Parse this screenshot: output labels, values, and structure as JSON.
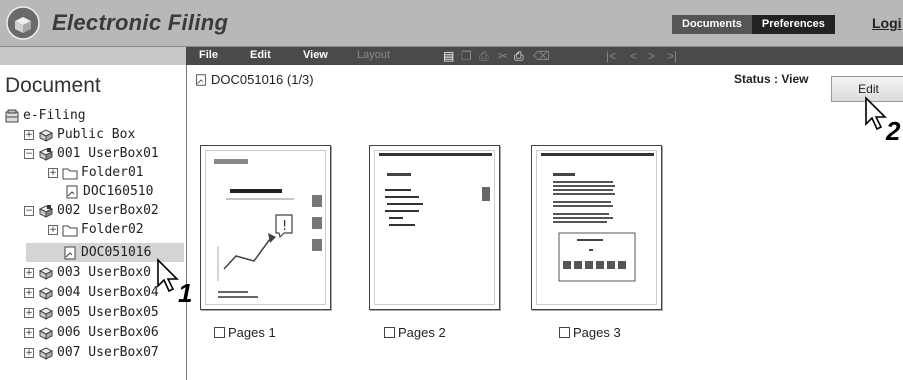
{
  "header": {
    "title": "Electronic Filing",
    "tabs": [
      {
        "label": "Documents"
      },
      {
        "label": "Preferences"
      }
    ],
    "login_label": "Logi"
  },
  "toolbar": {
    "menus": [
      {
        "label": "File"
      },
      {
        "label": "Edit"
      },
      {
        "label": "View"
      },
      {
        "label": "Layout"
      }
    ],
    "icons": [
      "display-icon",
      "copy-icon",
      "print-icon",
      "cut-icon",
      "paste-icon",
      "delete-icon"
    ],
    "nav": [
      "|<",
      "<",
      ">",
      ">|"
    ]
  },
  "sidebar": {
    "title": "Document",
    "root": "e-Filing",
    "items": [
      {
        "label": "Public Box"
      },
      {
        "label": "001 UserBox01"
      },
      {
        "label": "Folder01"
      },
      {
        "label": "DOC160510"
      },
      {
        "label": "002 UserBox02"
      },
      {
        "label": "Folder02"
      },
      {
        "label": "DOC051016"
      },
      {
        "label": "003 UserBox0"
      },
      {
        "label": "004 UserBox04"
      },
      {
        "label": "005 UserBox05"
      },
      {
        "label": "006 UserBox06"
      },
      {
        "label": "007 UserBox07"
      }
    ]
  },
  "main": {
    "doc_title": "DOC051016 (1/3)",
    "status": "Status : View",
    "edit_label": "Edit",
    "pages": [
      {
        "label": "Pages 1"
      },
      {
        "label": "Pages 2"
      },
      {
        "label": "Pages 3"
      }
    ]
  },
  "callouts": {
    "one": "1",
    "two": "2"
  }
}
